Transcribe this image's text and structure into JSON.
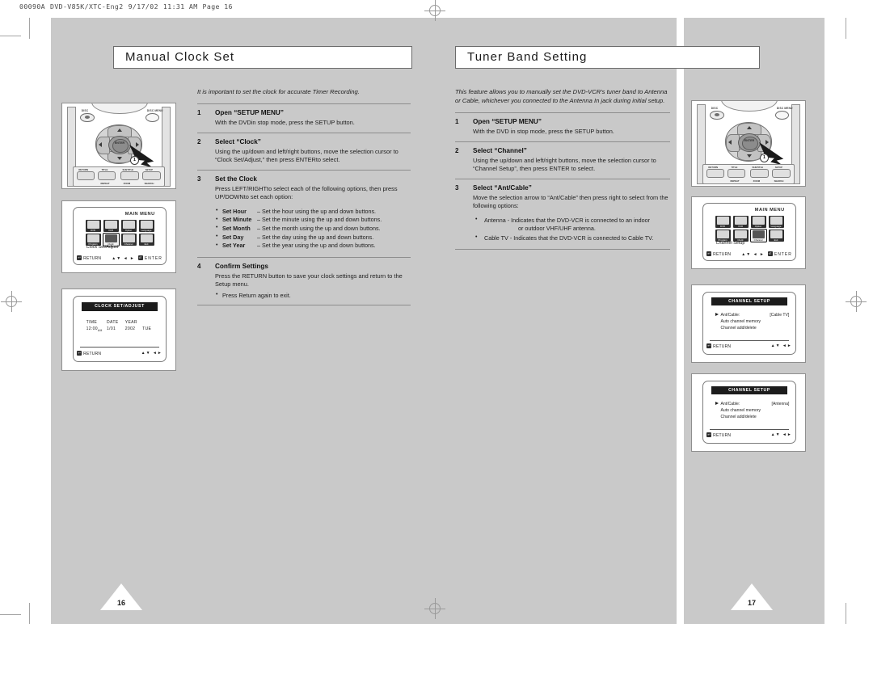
{
  "slug": {
    "job": "00090A",
    "file": "DVD-V85K/XTC-Eng2",
    "date": "9/17/02",
    "time": "11:31 AM",
    "page": "Page 16"
  },
  "left_page": {
    "title": "Manual Clock Set",
    "page_number": "16",
    "intro": "It is important to set the clock for accurate Timer Recording.",
    "steps": [
      {
        "num": "1",
        "heading": "Open “SETUP MENU”",
        "text": "With the DVDin stop mode, press the SETUP button."
      },
      {
        "num": "2",
        "heading": "Select “Clock”",
        "text": "Using the up/down and left/right buttons, move the selection cursor to “Clock Set/Adjust,” then press ENTERto select."
      },
      {
        "num": "3",
        "heading": "Set the Clock",
        "text": "Press LEFT/RIGHTto select each of the following options, then press UP/DOWNto set each option:",
        "options": [
          {
            "label": "Set Hour",
            "text": "– Set the hour using the up and down buttons."
          },
          {
            "label": "Set Minute",
            "text": "– Set the minute using the up and down buttons."
          },
          {
            "label": "Set Month",
            "text": "– Set the month using the up and down buttons."
          },
          {
            "label": "Set Day",
            "text": "– Set the day using the up and down buttons."
          },
          {
            "label": "Set Year",
            "text": "– Set the year using the up and down buttons."
          }
        ]
      },
      {
        "num": "4",
        "heading": "Confirm Settings",
        "text": "Press the RETURN button to save your clock settings and return to the Setup menu.",
        "note": "Press Return again to exit."
      }
    ],
    "remote": {
      "label_left": "DISC",
      "label_right": "DISC MENU",
      "enter_label": "ENTER",
      "callout": "1",
      "buttons": [
        {
          "top": "RETURN",
          "bottom": ""
        },
        {
          "top": "TITLE",
          "bottom": "REPEAT"
        },
        {
          "top": "SUBTITLE",
          "bottom": "ZOOM"
        },
        {
          "top": "SETUP",
          "bottom": "SEARCH"
        }
      ]
    },
    "main_menu": {
      "title": "MAIN MENU",
      "icons_row1": [
        "DVD",
        "VCR",
        "Option",
        "Language"
      ],
      "icons_row2": [
        "Program",
        "Clock",
        "Channel",
        "Exit"
      ],
      "selected_icon": "Clock",
      "selected_label": "Clock Set/Adjust",
      "return_label": "RETURN",
      "enter_label": "ENTER",
      "return_glyph": "↩",
      "enter_glyph": "⏎",
      "nav_glyph": "▲▼ ◄ ►"
    },
    "clock_screen": {
      "title": "CLOCK SET/ADJUST",
      "headers": [
        "TIME",
        "DATE",
        "YEAR",
        ""
      ],
      "values": [
        "12:00",
        "1/01",
        "2002",
        "TUE"
      ],
      "ampm": "AM",
      "return_label": "RETURN",
      "return_glyph": "↩",
      "nav_glyph": "▲▼  ◄►"
    }
  },
  "right_page": {
    "title": "Tuner Band Setting",
    "page_number": "17",
    "intro": "This feature allows you to manually set the DVD-VCR's tuner band to Antenna or Cable, whichever you connected to the Antenna In jack during initial setup.",
    "steps": [
      {
        "num": "1",
        "heading": "Open “SETUP MENU”",
        "text": "With the DVD in stop mode, press the SETUP button."
      },
      {
        "num": "2",
        "heading": "Select “Channel”",
        "text": "Using the up/down and left/right buttons, move the selection cursor to “Channel Setup”, then press ENTER to select."
      },
      {
        "num": "3",
        "heading": "Select “Ant/Cable”",
        "text": "Move the selection arrow to “Ant/Cable” then press right to select from the following options:",
        "options": [
          {
            "text": "Antenna - Indicates that the DVD-VCR is connected to an indoor",
            "cont": "or outdoor VHF/UHF antenna."
          },
          {
            "text": "Cable TV - Indicates that the DVD-VCR is connected to Cable TV.",
            "cont": ""
          }
        ]
      }
    ],
    "remote": {
      "label_left": "DISC",
      "label_right": "DISC MENU",
      "enter_label": "ENTER",
      "callout": "1",
      "buttons": [
        {
          "top": "RETURN",
          "bottom": ""
        },
        {
          "top": "TITLE",
          "bottom": "REPEAT"
        },
        {
          "top": "SUBTITLE",
          "bottom": "ZOOM"
        },
        {
          "top": "SETUP",
          "bottom": "SEARCH"
        }
      ]
    },
    "main_menu": {
      "title": "MAIN MENU",
      "icons_row1": [
        "DVD",
        "VCR",
        "Option",
        "Language"
      ],
      "icons_row2": [
        "Program",
        "Clock",
        "Channel",
        "Exit"
      ],
      "selected_icon": "Channel",
      "selected_label": "Channel Setup",
      "return_label": "RETURN",
      "enter_label": "ENTER",
      "return_glyph": "↩",
      "enter_glyph": "⏎",
      "nav_glyph": "▲▼ ◄ ►"
    },
    "channel_screen_cable": {
      "title": "CHANNEL SETUP",
      "rows": [
        {
          "label": "Ant/Cable:",
          "value": "[Cable TV]",
          "selected": true
        },
        {
          "label": "Auto channel memory",
          "value": "",
          "selected": false
        },
        {
          "label": "Channel add/delete",
          "value": "",
          "selected": false
        }
      ],
      "return_label": "RETURN",
      "return_glyph": "↩",
      "nav_glyph": "▲▼  ◄►"
    },
    "channel_screen_antenna": {
      "title": "CHANNEL SETUP",
      "rows": [
        {
          "label": "Ant/Cable:",
          "value": "[Antenna]",
          "selected": true
        },
        {
          "label": "Auto channel memory",
          "value": "",
          "selected": false
        },
        {
          "label": "Channel add/delete",
          "value": "",
          "selected": false
        }
      ],
      "return_label": "RETURN",
      "return_glyph": "↩",
      "nav_glyph": "▲▼  ◄►"
    }
  },
  "colors": {
    "page_background": "#c9c9c9",
    "paper": "#ffffff",
    "text": "#1d1d1d",
    "rule": "#8d8d8d",
    "osd_bar": "#1c1c1c"
  }
}
